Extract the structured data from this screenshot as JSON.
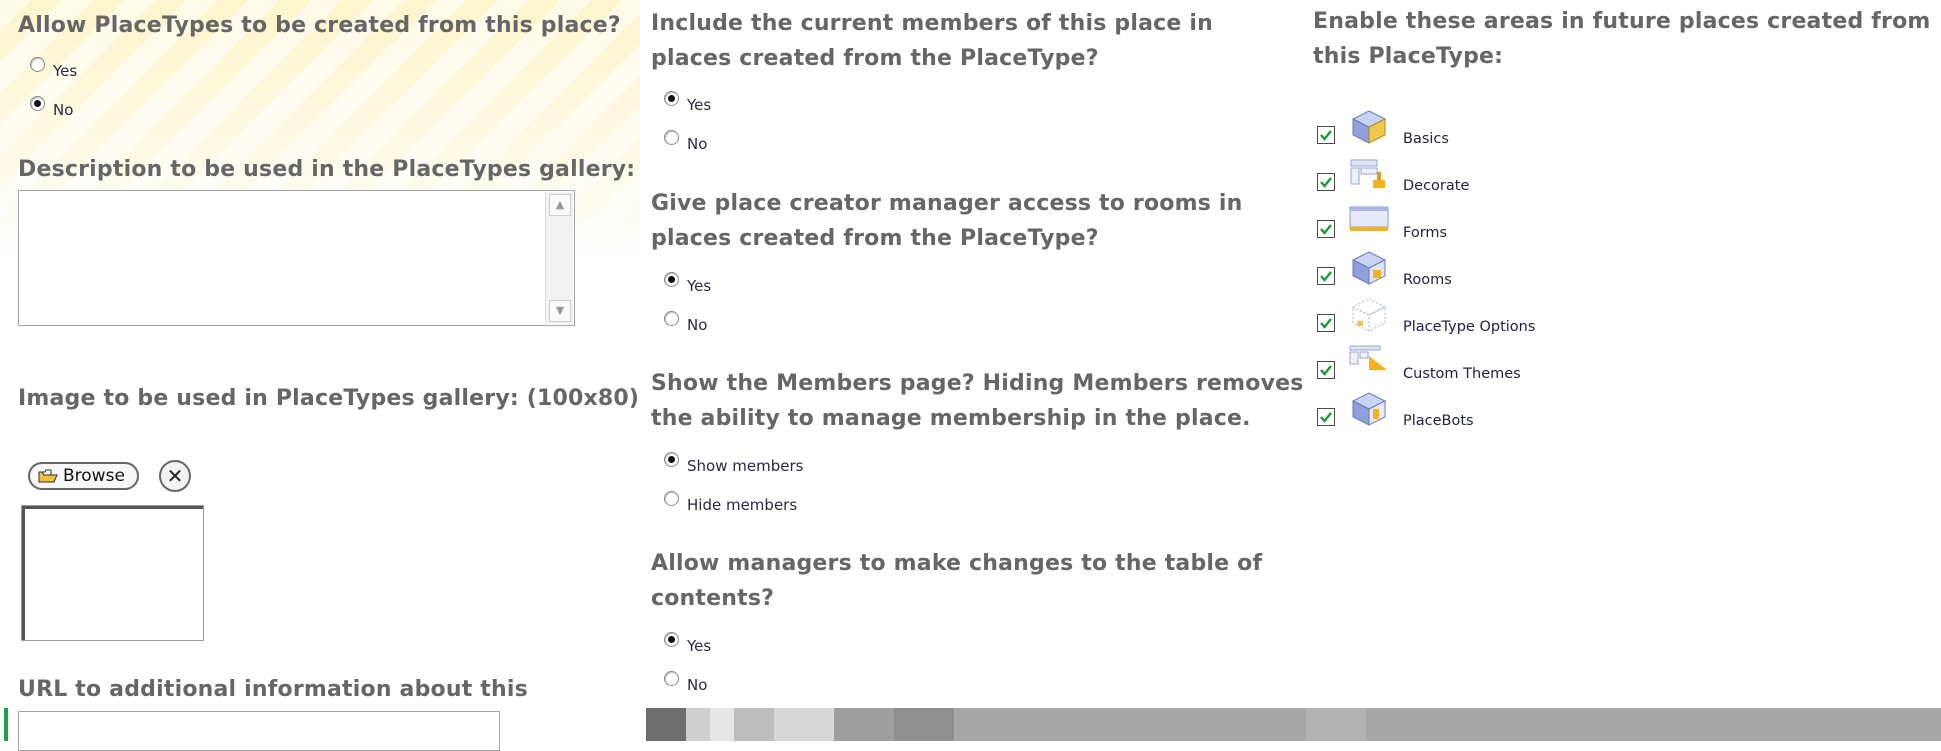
{
  "left": {
    "allow_question": "Allow PlaceTypes to be created from this place?",
    "allow_options": [
      "Yes",
      "No"
    ],
    "allow_selected": "No",
    "description_label": "Description to be used in the PlaceTypes gallery:",
    "description_value": "",
    "image_label": "Image to be used in PlaceTypes gallery: (100x80)",
    "browse_label": "Browse",
    "url_label": "URL to additional information about this PlaceType:",
    "url_value": ""
  },
  "middle": {
    "q1": "Include the current members of this place in places created from the PlaceType?",
    "q1_options": [
      "Yes",
      "No"
    ],
    "q1_selected": "Yes",
    "q2": "Give place creator manager access to rooms in places created from the PlaceType?",
    "q2_options": [
      "Yes",
      "No"
    ],
    "q2_selected": "Yes",
    "q3": "Show the Members page? Hiding Members removes the ability to manage membership in the place.",
    "q3_options": [
      "Show members",
      "Hide members"
    ],
    "q3_selected": "Show members",
    "q4": "Allow managers to make changes to the table of contents?",
    "q4_options": [
      "Yes",
      "No"
    ],
    "q4_selected": "Yes"
  },
  "right": {
    "title": "Enable these areas in future places created from this PlaceType:",
    "areas": [
      {
        "label": "Basics",
        "checked": true,
        "icon": "cube-icon"
      },
      {
        "label": "Decorate",
        "checked": true,
        "icon": "decorate-icon"
      },
      {
        "label": "Forms",
        "checked": true,
        "icon": "forms-icon"
      },
      {
        "label": "Rooms",
        "checked": true,
        "icon": "rooms-icon"
      },
      {
        "label": "PlaceType Options",
        "checked": true,
        "icon": "wireframe-cube-icon"
      },
      {
        "label": "Custom Themes",
        "checked": true,
        "icon": "themes-icon"
      },
      {
        "label": "PlaceBots",
        "checked": true,
        "icon": "placebots-icon"
      }
    ]
  },
  "colors": {
    "question_text": "#666666",
    "option_text": "#2a2a44",
    "checkbox_check": "#1a9a3a",
    "highlight_bg": "#fcf6cc"
  }
}
